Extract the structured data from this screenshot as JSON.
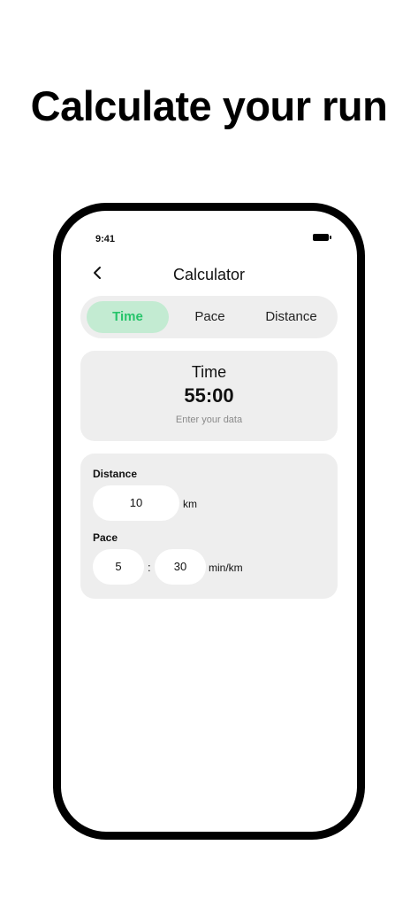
{
  "headline": "Calculate your run",
  "status_bar": {
    "time": "9:41"
  },
  "nav": {
    "title": "Calculator",
    "back_icon": "chevron-left-icon"
  },
  "tabs": [
    {
      "label": "Time",
      "active": true
    },
    {
      "label": "Pace",
      "active": false
    },
    {
      "label": "Distance",
      "active": false
    }
  ],
  "result": {
    "label": "Time",
    "value": "55:00",
    "hint": "Enter your data"
  },
  "inputs": {
    "distance": {
      "label": "Distance",
      "value": "10",
      "unit": "km"
    },
    "pace": {
      "label": "Pace",
      "minutes": "5",
      "separator": ":",
      "seconds": "30",
      "unit": "min/km"
    }
  },
  "colors": {
    "accent": "#26c46a",
    "accent_bg": "#c3ebd2",
    "card_bg": "#eeeeee"
  }
}
